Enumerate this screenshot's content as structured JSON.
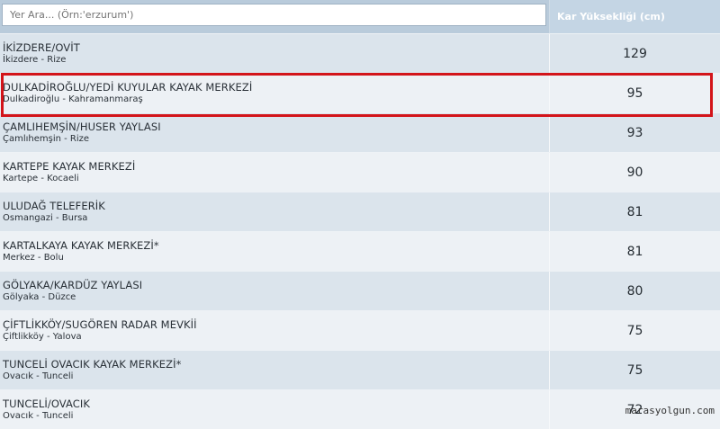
{
  "search": {
    "placeholder": "Yer Ara... (Örn:'erzurum')"
  },
  "header": {
    "value_column": "Kar Yüksekliği (cm)"
  },
  "rows": [
    {
      "name": "İKİZDERE/OVİT",
      "loc": "İkizdere - Rize",
      "value": "129"
    },
    {
      "name": "DULKADİROĞLU/YEDİ KUYULAR KAYAK MERKEZİ",
      "loc": "Dulkadiroğlu - Kahramanmaraş",
      "value": "95"
    },
    {
      "name": "ÇAMLIHEMŞİN/HUSER YAYLASI",
      "loc": "Çamlıhemşin - Rize",
      "value": "93"
    },
    {
      "name": "KARTEPE KAYAK MERKEZİ",
      "loc": "Kartepe - Kocaeli",
      "value": "90"
    },
    {
      "name": "ULUDAĞ TELEFERİK",
      "loc": "Osmangazi - Bursa",
      "value": "81"
    },
    {
      "name": "KARTALKAYA KAYAK MERKEZİ*",
      "loc": "Merkez - Bolu",
      "value": "81"
    },
    {
      "name": "GÖLYAKA/KARDÜZ YAYLASI",
      "loc": "Gölyaka - Düzce",
      "value": "80"
    },
    {
      "name": "ÇİFTLİKKÖY/SUGÖREN RADAR MEVKİİ",
      "loc": "Çiftlikköy - Yalova",
      "value": "75"
    },
    {
      "name": "TUNCELİ OVACIK KAYAK MERKEZİ*",
      "loc": "Ovacık - Tunceli",
      "value": "75"
    },
    {
      "name": "TUNCELİ/OVACIK",
      "loc": "Ovacık - Tunceli",
      "value": "72"
    }
  ],
  "watermark": "marasyolgun.com"
}
